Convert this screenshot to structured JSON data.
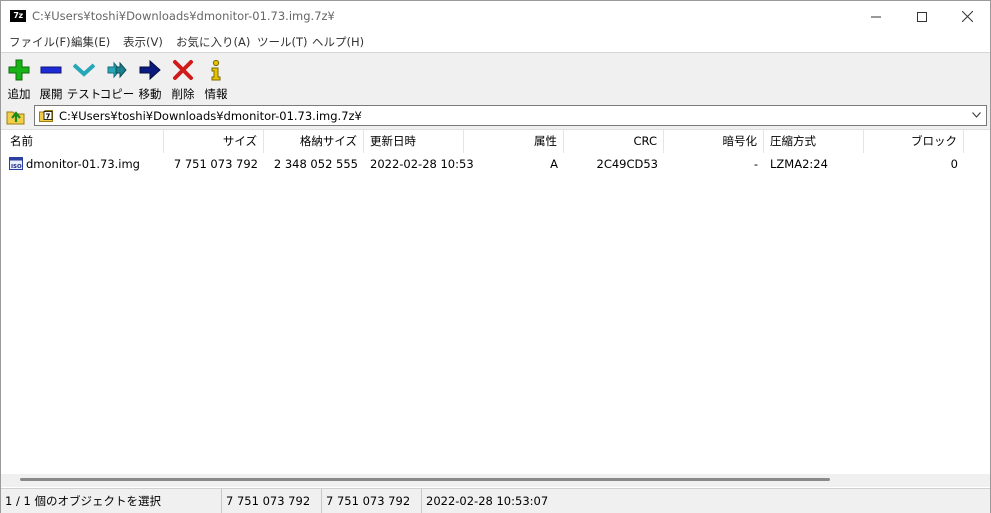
{
  "window": {
    "title": "C:¥Users¥toshi¥Downloads¥dmonitor-01.73.img.7z¥",
    "app_icon_text": "7z"
  },
  "menu": [
    {
      "label": "ファイル(F)"
    },
    {
      "label": "編集(E)"
    },
    {
      "label": "表示(V)"
    },
    {
      "label": "お気に入り(A)"
    },
    {
      "label": "ツール(T)"
    },
    {
      "label": "ヘルプ(H)"
    }
  ],
  "toolbar": {
    "add": "追加",
    "extract": "展開",
    "test": "テスト",
    "copy": "コピー",
    "move": "移動",
    "delete": "削除",
    "info": "情報"
  },
  "address": {
    "path": "C:¥Users¥toshi¥Downloads¥dmonitor-01.73.img.7z¥",
    "icon_text": "7"
  },
  "columns": {
    "name": "名前",
    "size": "サイズ",
    "packed": "格納サイズ",
    "modified": "更新日時",
    "attributes": "属性",
    "crc": "CRC",
    "encrypted": "暗号化",
    "method": "圧縮方式",
    "block": "ブロック"
  },
  "files": [
    {
      "name": "dmonitor-01.73.img",
      "size": "7 751 073 792",
      "packed": "2 348 052 555",
      "modified": "2022-02-28 10:53",
      "attributes": "A",
      "crc": "2C49CD53",
      "encrypted": "-",
      "method": "LZMA2:24",
      "block": "0",
      "icon_text": "ISO"
    }
  ],
  "status": {
    "selection": "1 / 1 個のオブジェクトを選択",
    "size": "7 751 073 792",
    "packed": "7 751 073 792",
    "modified": "2022-02-28 10:53:07"
  },
  "colors": {
    "add_green": "#19b219",
    "extract_blue": "#1c2bd6",
    "test_teal": "#27a6b8",
    "move_navy": "#0a1a80",
    "delete_red": "#d11a1a",
    "info_yellow": "#e5c400",
    "toolbar_bg": "#f0f0f0"
  }
}
